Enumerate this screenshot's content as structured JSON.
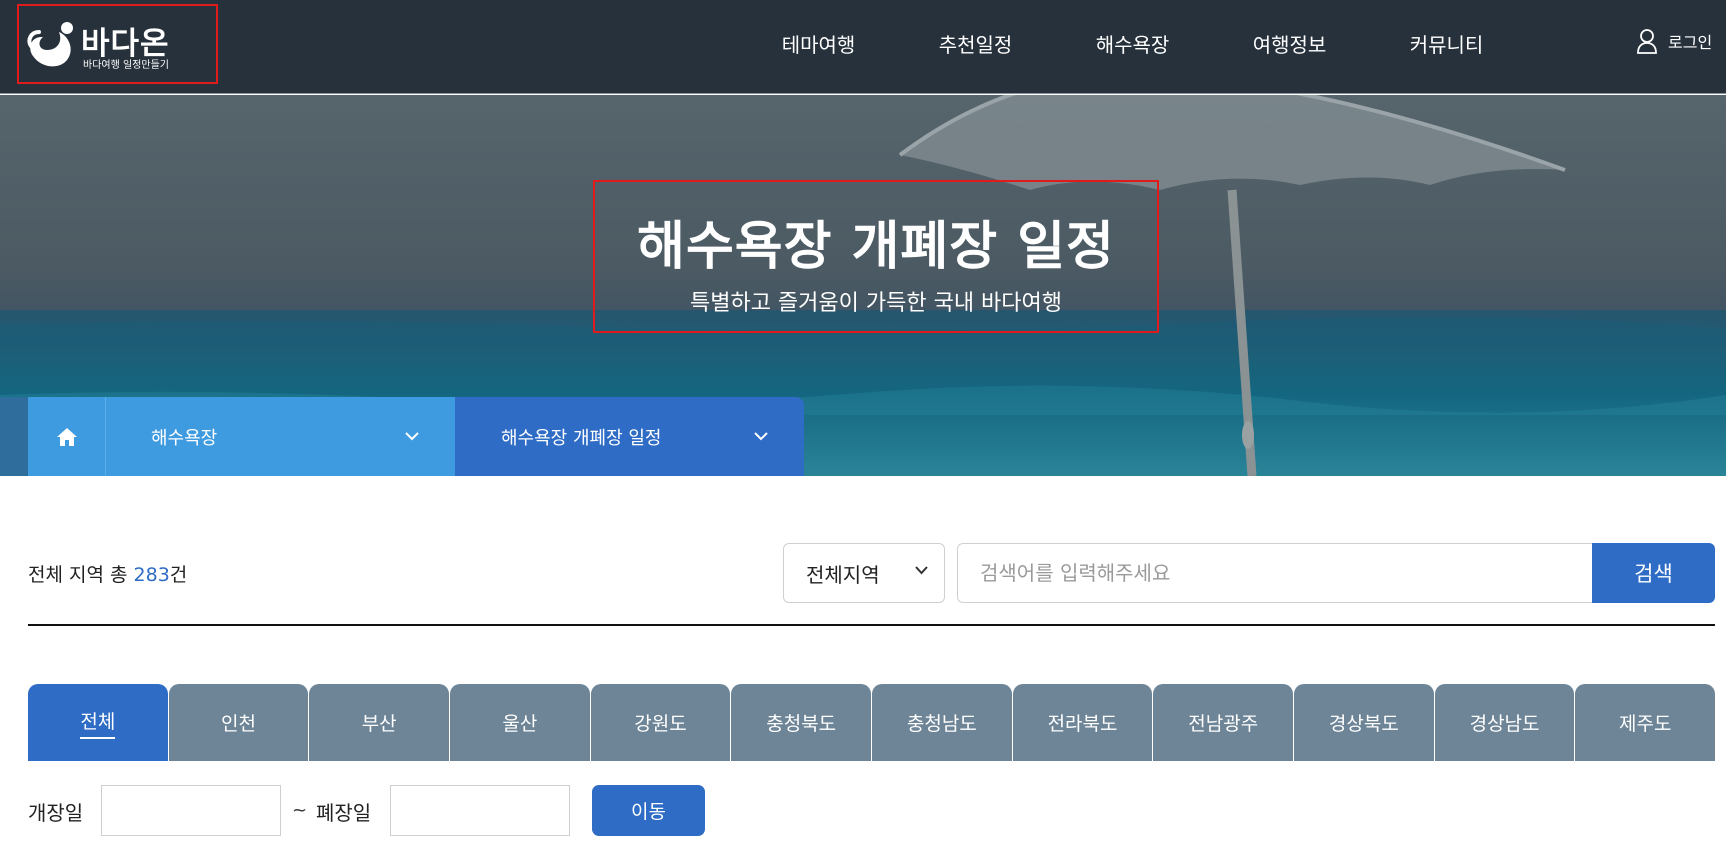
{
  "header": {
    "logo_title": "바다온",
    "logo_subtitle": "바다여행 일정만들기",
    "nav": [
      "테마여행",
      "추천일정",
      "해수욕장",
      "여행정보",
      "커뮤니티"
    ],
    "login_label": "로그인"
  },
  "hero": {
    "title": "해수욕장 개폐장 일정",
    "subtitle": "특별하고 즐거움이 가득한 국내 바다여행"
  },
  "breadcrumb": {
    "level1": "해수욕장",
    "level2": "해수욕장 개폐장 일정"
  },
  "results": {
    "prefix": "전체 지역 총 ",
    "count": "283",
    "suffix": "건"
  },
  "search": {
    "region_selected": "전체지역",
    "placeholder": "검색어를 입력해주세요",
    "button_label": "검색"
  },
  "tabs": [
    "전체",
    "인천",
    "부산",
    "울산",
    "강원도",
    "충청북도",
    "충청남도",
    "전라북도",
    "전남광주",
    "경상북도",
    "경상남도",
    "제주도"
  ],
  "active_tab": "전체",
  "date_filter": {
    "open_label": "개장일",
    "separator": "~",
    "close_label": "폐장일",
    "go_label": "이동"
  },
  "colors": {
    "header_bg": "#27313c",
    "accent_blue": "#2e6cc6",
    "light_blue": "#3f9be0",
    "tab_gray": "#6e8597",
    "highlight_red": "#e01b1b"
  },
  "icons": [
    "wave-logo-icon",
    "user-icon",
    "home-icon",
    "chevron-down-icon"
  ]
}
